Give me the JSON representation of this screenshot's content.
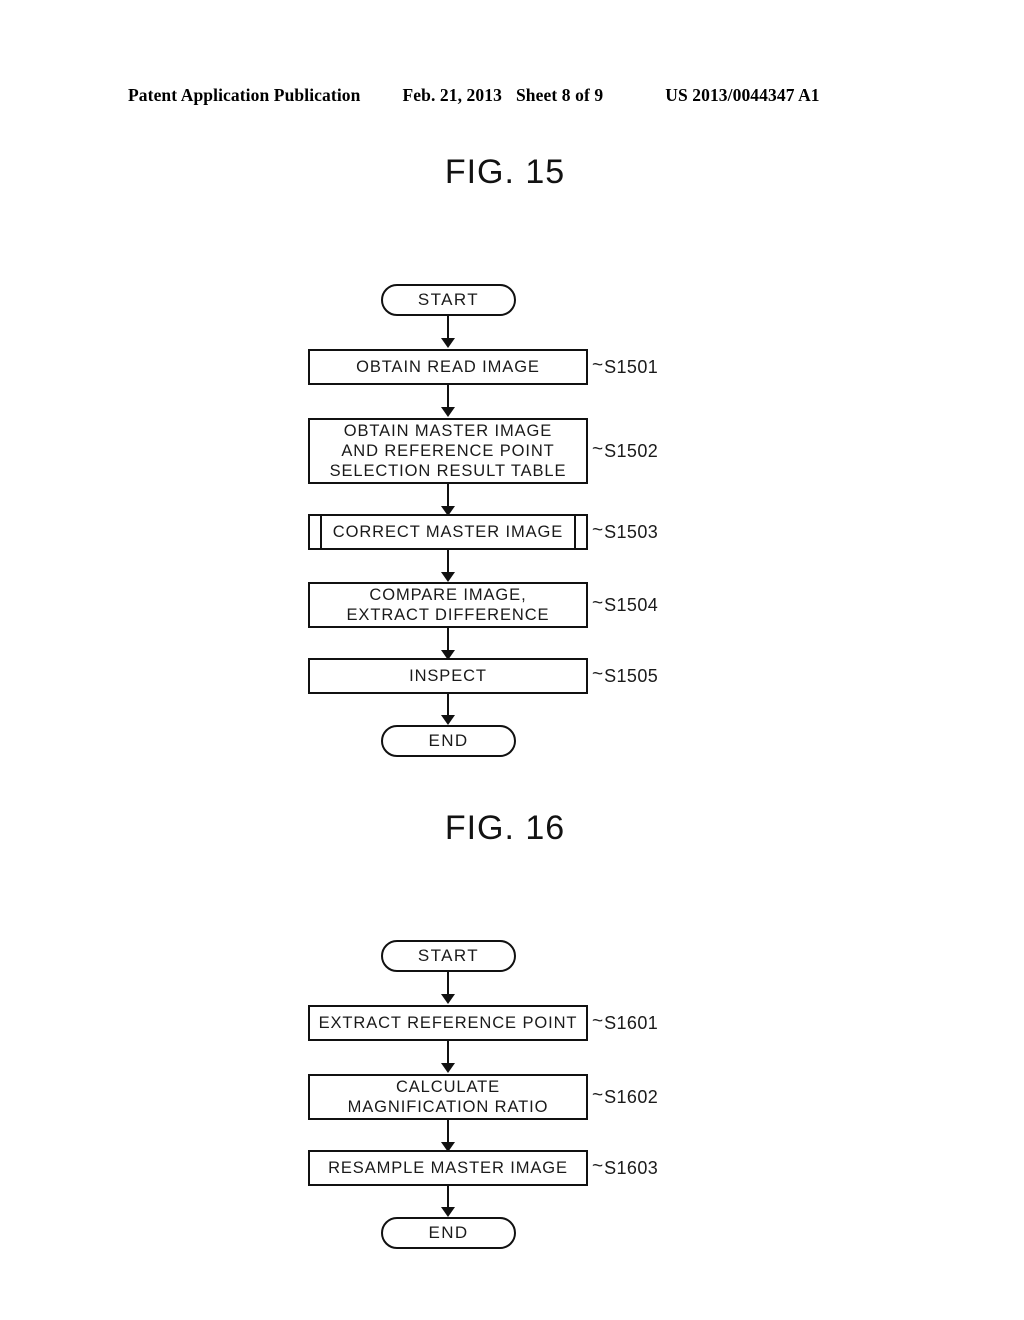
{
  "header": {
    "publication": "Patent Application Publication",
    "date": "Feb. 21, 2013",
    "sheet": "Sheet 8 of 9",
    "patent_number": "US 2013/0044347 A1"
  },
  "figures": [
    {
      "title": "FIG. 15",
      "start_label": "START",
      "end_label": "END",
      "steps": [
        {
          "text": "OBTAIN READ IMAGE",
          "code": "S1501",
          "shape": "process"
        },
        {
          "text": "OBTAIN MASTER IMAGE\nAND REFERENCE POINT\nSELECTION RESULT TABLE",
          "code": "S1502",
          "shape": "process"
        },
        {
          "text": "CORRECT MASTER IMAGE",
          "code": "S1503",
          "shape": "predefined-process"
        },
        {
          "text": "COMPARE IMAGE,\nEXTRACT DIFFERENCE",
          "code": "S1504",
          "shape": "process"
        },
        {
          "text": "INSPECT",
          "code": "S1505",
          "shape": "process"
        }
      ]
    },
    {
      "title": "FIG. 16",
      "start_label": "START",
      "end_label": "END",
      "steps": [
        {
          "text": "EXTRACT REFERENCE POINT",
          "code": "S1601",
          "shape": "process"
        },
        {
          "text": "CALCULATE\nMAGNIFICATION RATIO",
          "code": "S1602",
          "shape": "process"
        },
        {
          "text": "RESAMPLE MASTER IMAGE",
          "code": "S1603",
          "shape": "process"
        }
      ]
    }
  ],
  "symbols": {
    "tilde": "~"
  },
  "colors": {
    "ink": "#111111",
    "paper": "#ffffff"
  }
}
